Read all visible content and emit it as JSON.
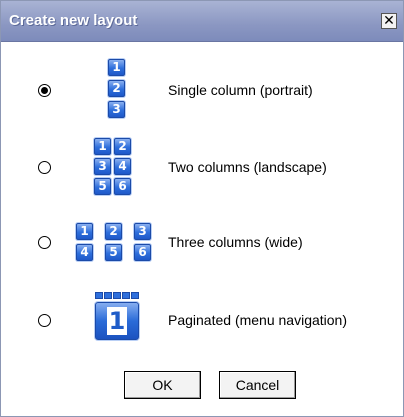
{
  "dialog": {
    "title": "Create new layout",
    "close_glyph": "✕"
  },
  "options": [
    {
      "label": "Single column (portrait)",
      "selected": true,
      "icon": "single-column-layout-icon",
      "tiles": [
        "1",
        "2",
        "3"
      ]
    },
    {
      "label": "Two columns (landscape)",
      "selected": false,
      "icon": "two-columns-layout-icon",
      "tiles": [
        "1",
        "2",
        "3",
        "4",
        "5",
        "6"
      ]
    },
    {
      "label": "Three columns (wide)",
      "selected": false,
      "icon": "three-columns-layout-icon",
      "tiles": [
        "1",
        "2",
        "3",
        "4",
        "5",
        "6"
      ]
    },
    {
      "label": "Paginated (menu navigation)",
      "selected": false,
      "icon": "paginated-layout-icon",
      "tiles": [
        "1"
      ]
    }
  ],
  "buttons": {
    "ok": "OK",
    "cancel": "Cancel"
  },
  "colors": {
    "titlebar": "#8b97c2",
    "tile_blue": "#2e6fdc"
  }
}
